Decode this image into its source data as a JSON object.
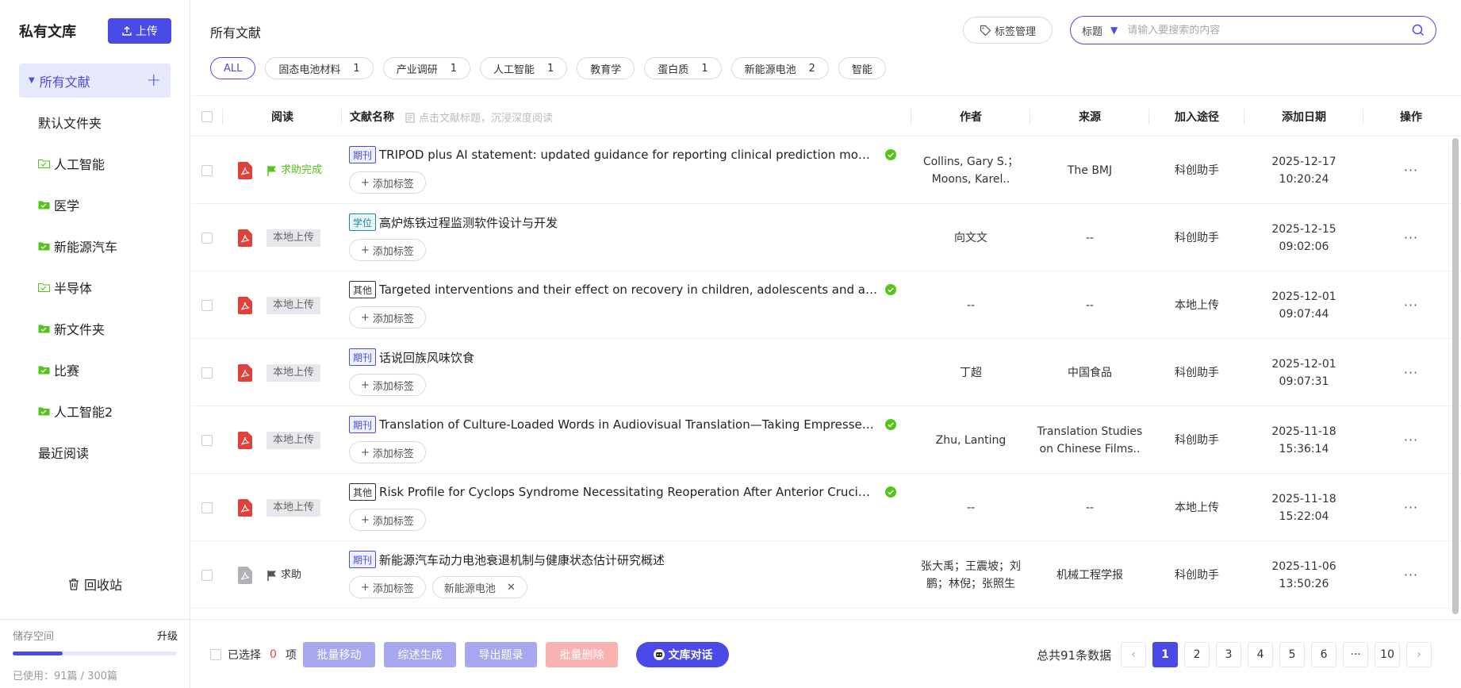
{
  "sidebar": {
    "title": "私有文库",
    "upload_label": "上传",
    "all_label": "所有文献",
    "items": [
      {
        "label": "默认文件夹",
        "type": "top"
      },
      {
        "label": "人工智能",
        "type": "folder-outline"
      },
      {
        "label": "医学",
        "type": "folder"
      },
      {
        "label": "新能源汽车",
        "type": "folder"
      },
      {
        "label": "半导体",
        "type": "folder-outline"
      },
      {
        "label": "新文件夹",
        "type": "folder"
      },
      {
        "label": "比赛",
        "type": "folder"
      },
      {
        "label": "人工智能2",
        "type": "folder"
      },
      {
        "label": "最近阅读",
        "type": "top"
      }
    ],
    "recycle_label": "回收站",
    "storage": {
      "label": "储存空间",
      "upgrade": "升级",
      "used_text": "已使用：91篇 / 300篇",
      "used_fraction": 0.3033
    }
  },
  "header": {
    "title": "所有文献",
    "tag_manage": "标签管理",
    "search_field": "标题",
    "search_placeholder": "请输入要搜索的内容"
  },
  "tags": [
    {
      "label": "ALL",
      "count": "",
      "active": true
    },
    {
      "label": "固态电池材料",
      "count": "1"
    },
    {
      "label": "产业调研",
      "count": "1"
    },
    {
      "label": "人工智能",
      "count": "1"
    },
    {
      "label": "教育学",
      "count": ""
    },
    {
      "label": "蛋白质",
      "count": "1"
    },
    {
      "label": "新能源电池",
      "count": "2"
    },
    {
      "label": "智能",
      "count": ""
    }
  ],
  "table": {
    "headers": {
      "read": "阅读",
      "name": "文献名称",
      "name_hint": "点击文献标题，沉浸深度阅读",
      "author": "作者",
      "source": "来源",
      "via": "加入途径",
      "date": "添加日期",
      "action": "操作"
    },
    "add_tag_label": "添加标签",
    "rows": [
      {
        "pdf_color": "#e0413d",
        "read_type": "help-done",
        "read_label": "求助完成",
        "badge": "期刊",
        "badge_type": "qk",
        "title": "TRIPOD plus AI statement: updated guidance for reporting clinical prediction models that u...",
        "checked": true,
        "tags": [],
        "author": "Collins, Gary S.；Moons, Karel..",
        "source": "The BMJ",
        "via": "科创助手",
        "date1": "2025-12-17",
        "date2": "10:20:24"
      },
      {
        "pdf_color": "#e0413d",
        "read_type": "local",
        "read_label": "本地上传",
        "badge": "学位",
        "badge_type": "xw",
        "title": "高炉炼铁过程监测软件设计与开发",
        "checked": false,
        "tags": [],
        "author": "向文文",
        "source": "--",
        "via": "科创助手",
        "date1": "2025-12-15",
        "date2": "09:02:06"
      },
      {
        "pdf_color": "#e0413d",
        "read_type": "local",
        "read_label": "本地上传",
        "badge": "其他",
        "badge_type": "qt",
        "title": "Targeted interventions and their effect on recovery in children, adolescents and adults who...",
        "checked": true,
        "tags": [],
        "author": "--",
        "source": "--",
        "via": "本地上传",
        "date1": "2025-12-01",
        "date2": "09:07:44"
      },
      {
        "pdf_color": "#e0413d",
        "read_type": "local",
        "read_label": "本地上传",
        "badge": "期刊",
        "badge_type": "qk",
        "title": "话说回族风味饮食",
        "checked": false,
        "tags": [],
        "author": "丁超",
        "source": "中国食品",
        "via": "科创助手",
        "date1": "2025-12-01",
        "date2": "09:07:31"
      },
      {
        "pdf_color": "#e0413d",
        "read_type": "local",
        "read_label": "本地上传",
        "badge": "期刊",
        "badge_type": "qk",
        "title": "Translation of Culture-Loaded Words in Audiovisual Translation—Taking Empresses in the...",
        "checked": true,
        "tags": [],
        "author": "Zhu, Lanting",
        "source": "Translation Studies on Chinese Films..",
        "via": "科创助手",
        "date1": "2025-11-18",
        "date2": "15:36:14"
      },
      {
        "pdf_color": "#e0413d",
        "read_type": "local",
        "read_label": "本地上传",
        "badge": "其他",
        "badge_type": "qt",
        "title": "Risk Profile for Cyclops Syndrome Necessitating Reoperation After Anterior Cruciate Ligame...",
        "checked": true,
        "tags": [],
        "author": "--",
        "source": "--",
        "via": "本地上传",
        "date1": "2025-11-18",
        "date2": "15:22:04"
      },
      {
        "pdf_color": "#b0b0b6",
        "read_type": "help",
        "read_label": "求助",
        "badge": "期刊",
        "badge_type": "qk",
        "title": "新能源汽车动力电池衰退机制与健康状态估计研究概述",
        "checked": false,
        "tags": [
          "新能源电池"
        ],
        "author": "张大禹；王震坡；刘鹏；林倪；张照生",
        "source": "机械工程学报",
        "via": "科创助手",
        "date1": "2025-11-06",
        "date2": "13:50:26"
      }
    ],
    "action_label": "···"
  },
  "footer": {
    "selected_prefix": "已选择",
    "selected_count": "0",
    "selected_suffix": "项",
    "batch_move": "批量移动",
    "summary": "综述生成",
    "export": "导出题录",
    "batch_delete": "批量删除",
    "chat": "文库对话",
    "total": "总共91条数据",
    "pages": [
      "1",
      "2",
      "3",
      "4",
      "5",
      "6",
      "···",
      "10"
    ],
    "current_page": "1"
  },
  "colors": {
    "accent": "#4a4be6",
    "green": "#52c41a",
    "red": "#e0413d"
  }
}
